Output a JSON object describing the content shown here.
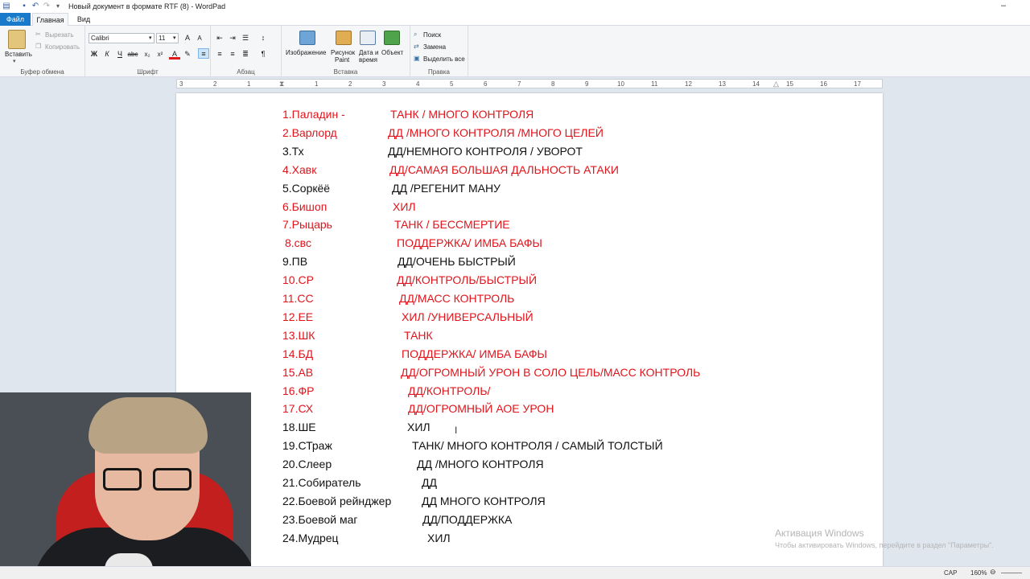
{
  "window": {
    "title": "Новый документ в формате RTF (8) - WordPad",
    "controls": {
      "minimize": "–"
    }
  },
  "tabs": [
    "Файл",
    "Главная",
    "Вид"
  ],
  "ribbon": {
    "clipboard": {
      "label": "Буфер обмена",
      "paste": "Вставить",
      "cut": "Вырезать",
      "copy": "Копировать"
    },
    "font": {
      "label": "Шрифт",
      "family": "Calibri",
      "size": "11"
    },
    "paragraph": {
      "label": "Абзац"
    },
    "insert": {
      "label": "Вставка",
      "image": "Изображение",
      "paint1": "Рисунок",
      "paint2": "Paint",
      "datetime1": "Дата и",
      "datetime2": "время",
      "object": "Объект"
    },
    "edit": {
      "label": "Правка",
      "find": "Поиск",
      "replace": "Замена",
      "select_all": "Выделить все"
    }
  },
  "ruler": [
    "3",
    "2",
    "1",
    "1",
    "2",
    "3",
    "4",
    "5",
    "6",
    "7",
    "8",
    "9",
    "10",
    "11",
    "12",
    "13",
    "14",
    "15",
    "16",
    "17"
  ],
  "document": {
    "lines": [
      {
        "name": "1.Паладин    -",
        "role": "ТАНК  /  МНОГО КОНТРОЛЯ",
        "color": "#e0141b"
      },
      {
        "name": "2.Варлорд",
        "role": "ДД /МНОГО КОНТРОЛЯ /МНОГО ЦЕЛЕЙ",
        "color": "#e0141b"
      },
      {
        "name": "3.Тх",
        "role": "ДД/НЕМНОГО КОНТРОЛЯ / УВОРОТ",
        "color": "#111111"
      },
      {
        "name": "4.Хавк",
        "role": "ДД/САМАЯ БОЛЬШАЯ ДАЛЬНОСТЬ АТАКИ",
        "color": "#e0141b"
      },
      {
        "name": "5.Соркёё",
        "role": "ДД /РЕГЕНИТ МАНУ",
        "color": "#111111"
      },
      {
        "name": "6.Бишоп",
        "role": "ХИЛ",
        "color": "#e0141b"
      },
      {
        "name": "7.Рыцарь",
        "role": "ТАНК / БЕССМЕРТИЕ",
        "color": "#e0141b"
      },
      {
        "name": "8.свс",
        "role": "ПОДДЕРЖКА/ ИМБА БАФЫ",
        "color": "#e0141b"
      },
      {
        "name": "9.ПВ",
        "role": "ДД/ОЧЕНЬ БЫСТРЫЙ",
        "color": "#111111"
      },
      {
        "name": "10.СР",
        "role": "ДД/КОНТРОЛЬ/БЫСТРЫЙ",
        "color": "#e0141b"
      },
      {
        "name": "11.СС",
        "role": "ДД/МАСС КОНТРОЛЬ",
        "color": "#e0141b"
      },
      {
        "name": "12.ЕЕ",
        "role": "ХИЛ /УНИВЕРСАЛЬНЫЙ",
        "color": "#e0141b"
      },
      {
        "name": "13.ШК",
        "role": "ТАНК",
        "color": "#e0141b"
      },
      {
        "name": "14.БД",
        "role": "ПОДДЕРЖКА/ ИМБА БАФЫ",
        "color": "#e0141b"
      },
      {
        "name": "15.АВ",
        "role": "ДД/ОГРОМНЫЙ УРОН  В СОЛО ЦЕЛЬ/МАСС КОНТРОЛЬ",
        "color": "#e0141b"
      },
      {
        "name": "16.ФР",
        "role": "ДД/КОНТРОЛЬ/",
        "color": "#e0141b"
      },
      {
        "name": "17.СХ",
        "role": "ДД/ОГРОМНЫЙ АОЕ УРОН",
        "color": "#e0141b"
      },
      {
        "name": "18.ШЕ",
        "role": "ХИЛ",
        "color": "#111111"
      },
      {
        "name": "19.СТраж",
        "role": "ТАНК/ МНОГО КОНТРОЛЯ / САМЫЙ ТОЛСТЫЙ",
        "color": "#111111"
      },
      {
        "name": "20.Слеер",
        "role": "ДД /МНОГО КОНТРОЛЯ",
        "color": "#111111"
      },
      {
        "name": "21.Собиратель",
        "role": "ДД",
        "color": "#111111"
      },
      {
        "name": "22.Боевой рейнджер",
        "role": "ДД МНОГО КОНТРОЛЯ",
        "color": "#111111"
      },
      {
        "name": "23.Боевой маг",
        "role": "ДД/ПОДДЕРЖКА",
        "color": "#111111"
      },
      {
        "name": "24.Мудрец",
        "role": "ХИЛ",
        "color": "#111111"
      }
    ]
  },
  "activation": {
    "title": "Активация Windows",
    "subtitle": "Чтобы активировать Windows, перейдите в раздел \"Параметры\"."
  },
  "status": {
    "caps": "CAP",
    "zoom": "160%"
  },
  "colors": {
    "red_text": "#e0141b",
    "black_text": "#111111",
    "file_tab": "#1979ca"
  }
}
